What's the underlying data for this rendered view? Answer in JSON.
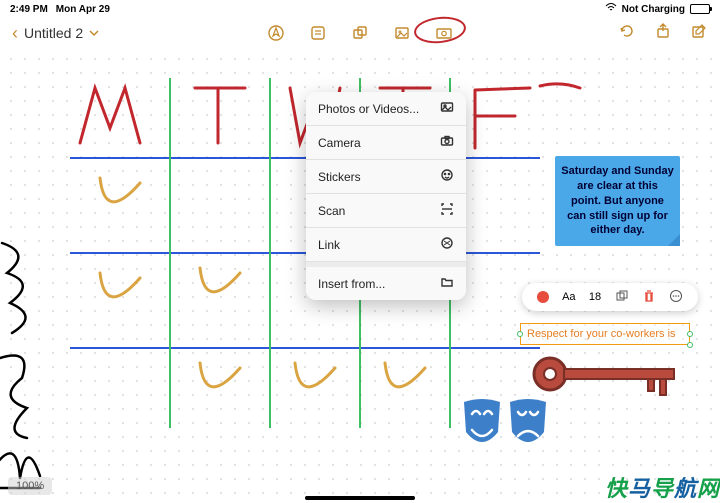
{
  "status": {
    "time": "2:49 PM",
    "date": "Mon Apr 29",
    "charging": "Not Charging"
  },
  "nav": {
    "title": "Untitled 2"
  },
  "toolbar_icons": [
    "pen-tool-icon",
    "text-tool-icon",
    "shapes-tool-icon",
    "media-tool-icon",
    "photo-tool-icon"
  ],
  "nav_right_icons": [
    "undo-icon",
    "share-icon",
    "compose-icon"
  ],
  "insert_menu": {
    "items": [
      {
        "label": "Photos or Videos...",
        "icon": "photos-icon"
      },
      {
        "label": "Camera",
        "icon": "camera-icon"
      },
      {
        "label": "Stickers",
        "icon": "stickers-icon"
      },
      {
        "label": "Scan",
        "icon": "scan-icon"
      },
      {
        "label": "Link",
        "icon": "link-icon"
      },
      {
        "label": "Insert from...",
        "icon": "folder-icon"
      }
    ]
  },
  "sticky_note": {
    "text": "Saturday and Sunday are clear at this point. But anyone can still sign up for either day."
  },
  "format_bar": {
    "font_label": "Aa",
    "font_size": "18"
  },
  "text_box": {
    "text": "Respect for your co-workers is"
  },
  "handwriting": {
    "days": [
      "M",
      "T",
      "W",
      "T",
      "F"
    ],
    "checkmarks_rows": 3
  },
  "colors": {
    "accent": "#c28a2d",
    "grid_blue": "#2b56d8",
    "grid_green": "#3fbf64",
    "ink_red": "#c1272d",
    "ink_orange": "#d9a441",
    "sticky_blue": "#4aa7e8",
    "mask_blue": "#3d7fc8",
    "key_red": "#b84b3e"
  },
  "zoom": {
    "label": "100%"
  },
  "watermark": {
    "text": "快马导航网"
  }
}
